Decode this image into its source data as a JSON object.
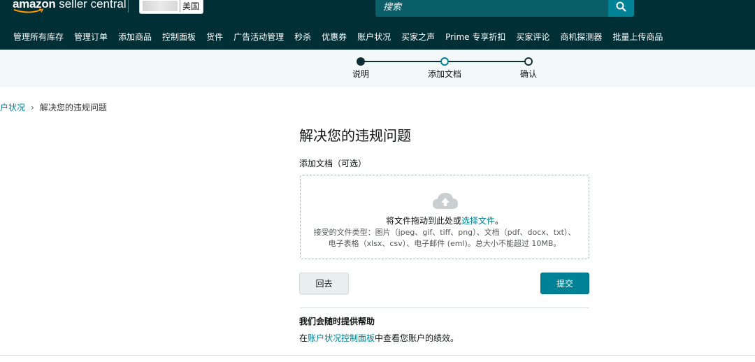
{
  "header": {
    "logo_prefix": "amazon",
    "logo_suffix": " seller central",
    "marketplace": "美国",
    "search_placeholder": "搜索"
  },
  "nav": {
    "items": [
      "管理所有库存",
      "管理订单",
      "添加商品",
      "控制面板",
      "货件",
      "广告活动管理",
      "秒杀",
      "优惠券",
      "账户状况",
      "买家之声",
      "Prime 专享折扣",
      "买家评论",
      "商机探测器",
      "批量上传商品"
    ]
  },
  "stepper": {
    "steps": [
      {
        "label": "说明",
        "state": "done"
      },
      {
        "label": "添加文档",
        "state": "current"
      },
      {
        "label": "确认",
        "state": "todo"
      }
    ]
  },
  "breadcrumb": {
    "parent": "账户状况",
    "current": "解决您的违规问题"
  },
  "main": {
    "title": "解决您的违规问题",
    "upload_label": "添加文档（可选）",
    "drop_text_before": "将文件拖动到此处或",
    "drop_link": "选择文件",
    "drop_text_after": "。",
    "file_types": "接受的文件类型：图片（jpeg、gif、tiff、png）、文档（pdf、docx、txt）、电子表格（xlsx、csv）、电子邮件 (eml)。总大小不能超过 10MB。",
    "back_label": "回去",
    "submit_label": "提交"
  },
  "help": {
    "title": "我们会随时提供帮助",
    "text_before": "在",
    "link": "账户状况控制面板",
    "text_after": "中查看您账户的绩效。"
  },
  "colors": {
    "header_bg": "#002f36",
    "accent": "#008296",
    "stepper_bg": "#f3f9f9"
  }
}
